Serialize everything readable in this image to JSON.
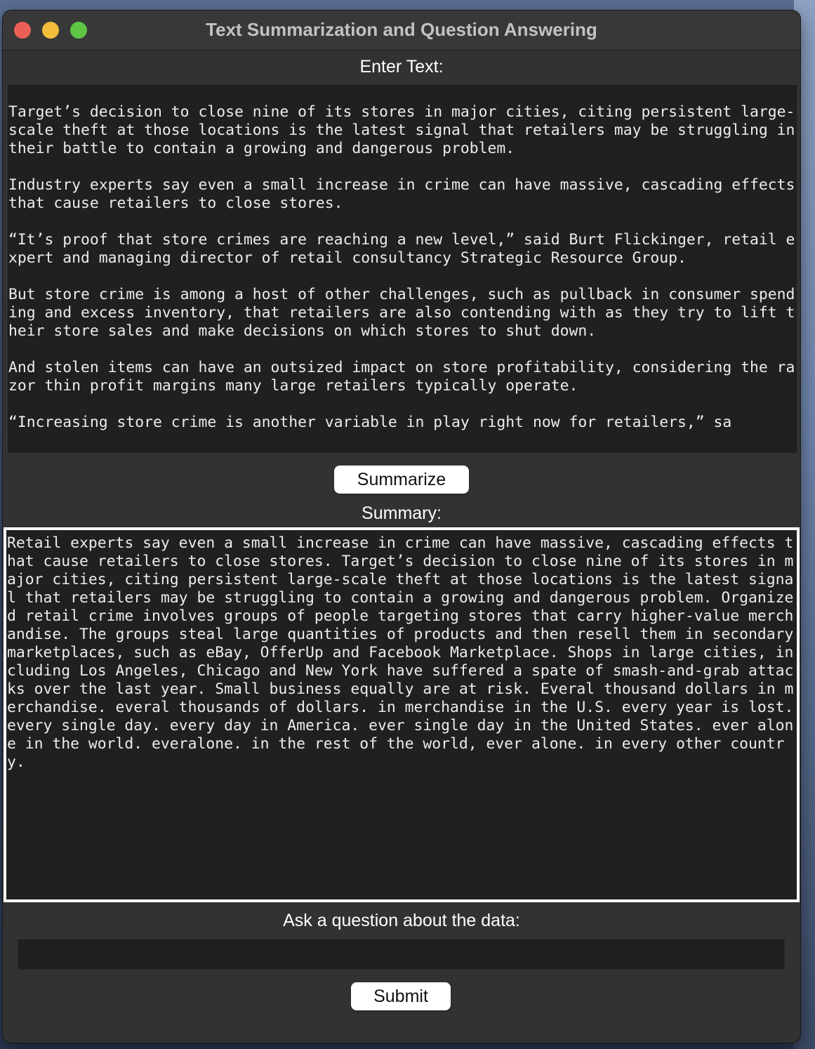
{
  "window": {
    "title": "Text Summarization and Question Answering"
  },
  "input_section": {
    "label": "Enter Text:",
    "text": "Target’s decision to close nine of its stores in major cities, citing persistent large-scale theft at those locations is the latest signal that retailers may be struggling in their battle to contain a growing and dangerous problem.\n\nIndustry experts say even a small increase in crime can have massive, cascading effects that cause retailers to close stores.\n\n“It’s proof that store crimes are reaching a new level,” said Burt Flickinger, retail expert and managing director of retail consultancy Strategic Resource Group.\n\nBut store crime is among a host of other challenges, such as pullback in consumer spending and excess inventory, that retailers are also contending with as they try to lift their store sales and make decisions on which stores to shut down.\n\nAnd stolen items can have an outsized impact on store profitability, considering the razor thin profit margins many large retailers typically operate.\n\n“Increasing store crime is another variable in play right now for retailers,” sa"
  },
  "summarize_button": {
    "label": "Summarize"
  },
  "summary_section": {
    "label": "Summary:",
    "text": "Retail experts say even a small increase in crime can have massive, cascading effects that cause retailers to close stores. Target’s decision to close nine of its stores in major cities, citing persistent large-scale theft at those locations is the latest signal that retailers may be struggling to contain a growing and dangerous problem. Organized retail crime involves groups of people targeting stores that carry higher-value merchandise. The groups steal large quantities of products and then resell them in secondary marketplaces, such as eBay, OfferUp and Facebook Marketplace. Shops in large cities, including Los Angeles, Chicago and New York have suffered a spate of smash-and-grab attacks over the last year. Small business equally are at risk. Everal thousand dollars in merchandise. everal thousands of dollars. in merchandise in the U.S. every year is lost. every single day. every day in America. ever single day in the United States. ever alone in the world. everalone. in the rest of the world, ever alone. in every other country."
  },
  "question_section": {
    "label": "Ask a question about the data:",
    "input_value": ""
  },
  "submit_button": {
    "label": "Submit"
  }
}
